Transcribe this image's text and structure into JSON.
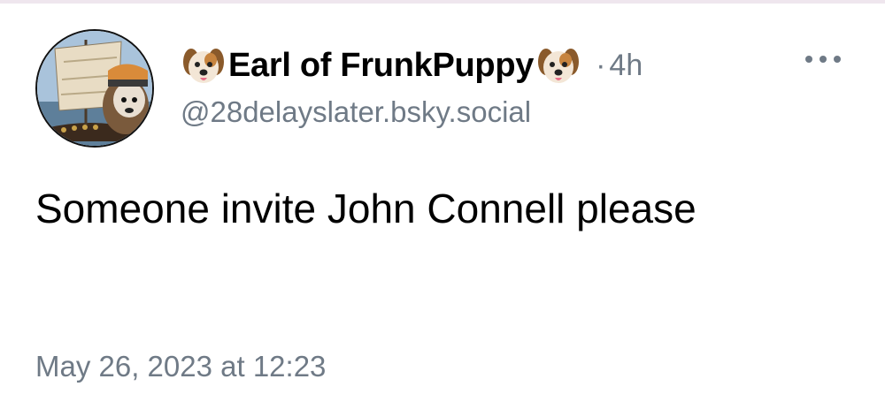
{
  "post": {
    "author": {
      "display_name": "Earl of FrunkPuppy",
      "name_emoji": "dog-face-icon",
      "handle": "@28delayslater.bsky.social",
      "avatar": "avatar-dog-on-viking-ship"
    },
    "separator": "·",
    "time_ago": "4h",
    "more_icon": "more-horizontal-icon",
    "text": "Someone invite John Connell please",
    "timestamp": "May 26, 2023 at 12:23"
  },
  "colors": {
    "text_primary": "#000000",
    "text_secondary": "#6f7a86",
    "background": "#ffffff"
  }
}
